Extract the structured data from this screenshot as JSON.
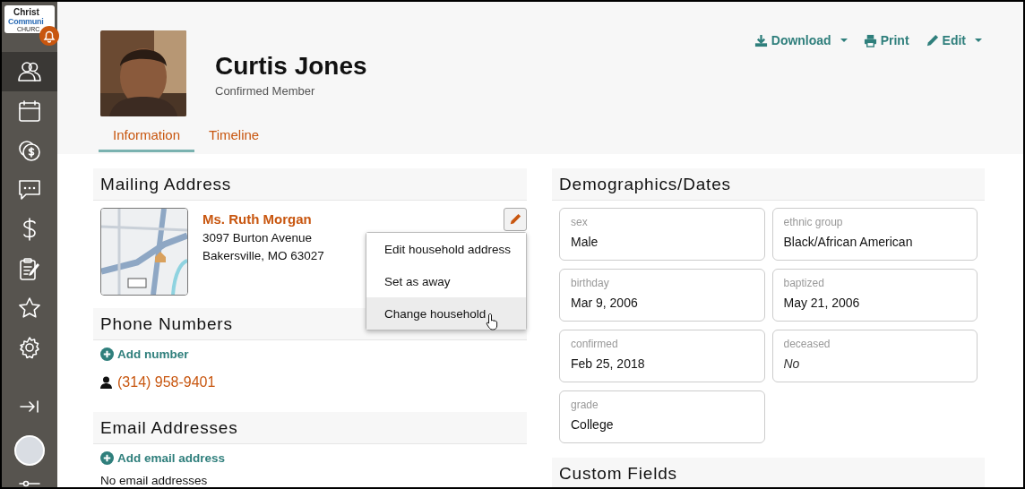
{
  "sidebar": {
    "logo": [
      "Christ",
      "Communi",
      "CHURC"
    ],
    "items": [
      {
        "selected": true
      },
      {
        "selected": false
      },
      {
        "selected": false
      },
      {
        "selected": false
      },
      {
        "selected": false
      },
      {
        "selected": false
      },
      {
        "selected": false
      },
      {
        "selected": false
      }
    ]
  },
  "header": {
    "name": "Curtis Jones",
    "status": "Confirmed Member",
    "actions": [
      {
        "label": "Download",
        "dropdown": true
      },
      {
        "label": "Print",
        "dropdown": false
      },
      {
        "label": "Edit",
        "dropdown": true
      }
    ],
    "tabs": [
      {
        "label": "Information",
        "selected": true
      },
      {
        "label": "Timeline",
        "selected": false
      }
    ]
  },
  "mailing": {
    "title": "Mailing Address",
    "name": "Ms. Ruth Morgan",
    "lines": [
      "3097 Burton Avenue",
      "Bakersville, MO 63027"
    ],
    "menu": [
      {
        "label": "Edit household address",
        "hovered": false
      },
      {
        "label": "Set as away",
        "hovered": false
      },
      {
        "label": "Change household",
        "hovered": true
      }
    ]
  },
  "phone": {
    "title": "Phone Numbers",
    "add": "Add number",
    "numbers": [
      "(314) 958-9401"
    ]
  },
  "email": {
    "title": "Email Addresses",
    "add": "Add email address",
    "empty": "No email addresses"
  },
  "demographics": {
    "title": "Demographics/Dates",
    "fields": [
      {
        "label": "sex",
        "value": "Male",
        "kind": "value"
      },
      {
        "label": "ethnic group",
        "value": "Black/African American",
        "kind": "value"
      },
      {
        "label": "birthday",
        "value": "Mar 9, 2006",
        "kind": "value"
      },
      {
        "label": "baptized",
        "value": "May 21, 2006",
        "kind": "value"
      },
      {
        "label": "confirmed",
        "value": "Feb 25, 2018",
        "kind": "value"
      },
      {
        "label": "deceased",
        "value": "No",
        "kind": "unset"
      },
      {
        "label": "grade",
        "value": "College",
        "kind": "value"
      }
    ]
  },
  "custom": {
    "title": "Custom Fields"
  }
}
